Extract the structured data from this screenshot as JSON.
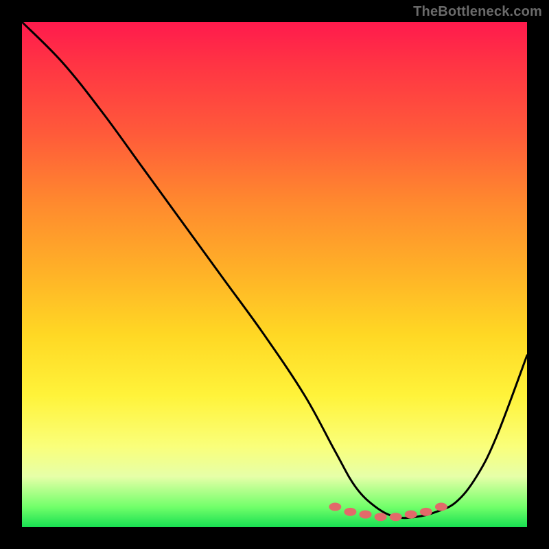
{
  "watermark": "TheBottleneck.com",
  "chart_data": {
    "type": "line",
    "title": "",
    "xlabel": "",
    "ylabel": "",
    "xlim": [
      0,
      100
    ],
    "ylim": [
      0,
      100
    ],
    "grid": false,
    "legend": false,
    "series": [
      {
        "name": "curve",
        "x": [
          0,
          8,
          16,
          24,
          32,
          40,
          48,
          56,
          62,
          66,
          70,
          74,
          78,
          82,
          86,
          90,
          94,
          100
        ],
        "y": [
          100,
          92,
          82,
          71,
          60,
          49,
          38,
          26,
          15,
          8,
          4,
          2,
          2,
          3,
          5,
          10,
          18,
          34
        ]
      }
    ],
    "markers": [
      {
        "x": 62,
        "y": 4
      },
      {
        "x": 65,
        "y": 3
      },
      {
        "x": 68,
        "y": 2.5
      },
      {
        "x": 71,
        "y": 2
      },
      {
        "x": 74,
        "y": 2
      },
      {
        "x": 77,
        "y": 2.5
      },
      {
        "x": 80,
        "y": 3
      },
      {
        "x": 83,
        "y": 4
      }
    ],
    "background_gradient_stops": [
      {
        "pct": 0,
        "color": "#ff1a4d"
      },
      {
        "pct": 22,
        "color": "#ff5a3a"
      },
      {
        "pct": 50,
        "color": "#ffb327"
      },
      {
        "pct": 74,
        "color": "#fff33a"
      },
      {
        "pct": 90,
        "color": "#e6ffa8"
      },
      {
        "pct": 100,
        "color": "#18e052"
      }
    ]
  }
}
